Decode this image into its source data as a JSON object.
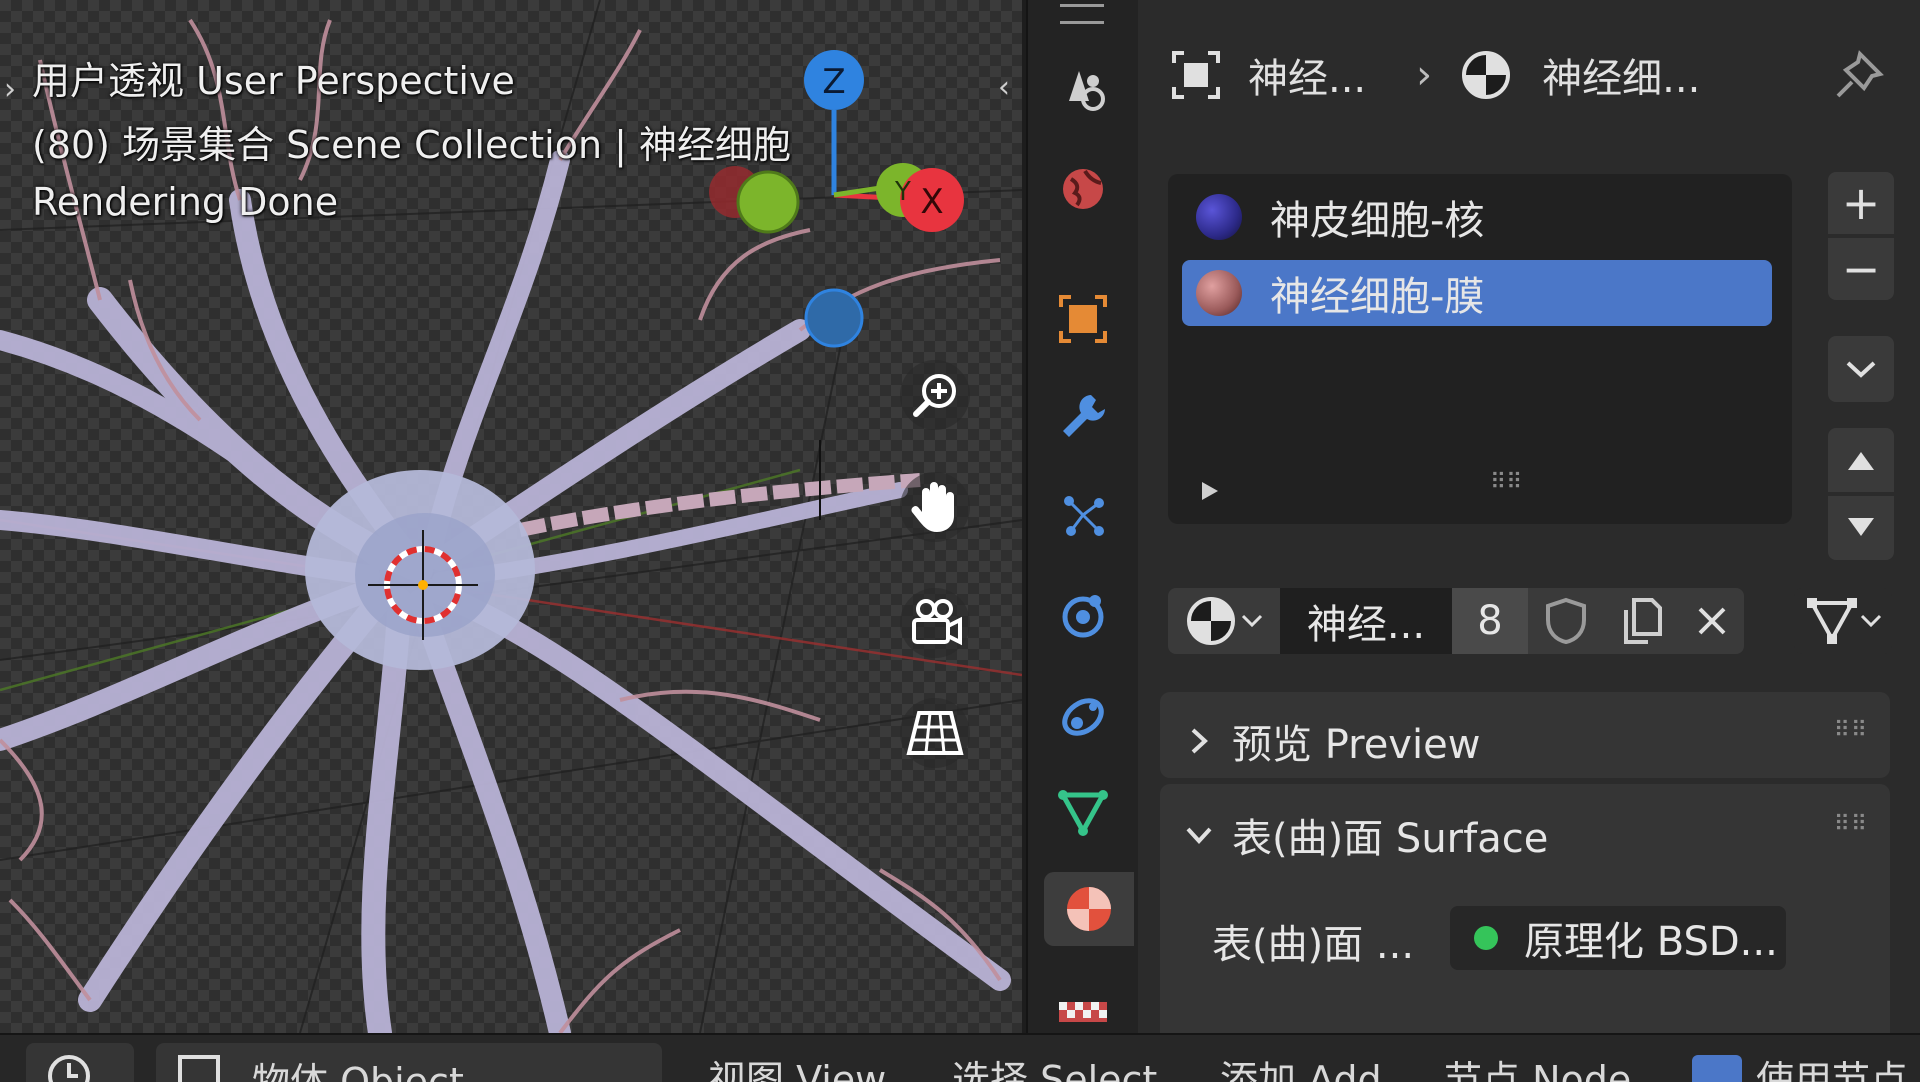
{
  "viewport": {
    "perspective_label": "用户透视 User Perspective",
    "collection_label": "(80) 场景集合 Scene Collection | 神经细胞",
    "status_label": "Rendering Done",
    "gizmo": {
      "z": "Z",
      "x": "X",
      "y": "Y"
    },
    "tools": [
      "zoom-icon",
      "pan-hand-icon",
      "camera-icon",
      "grid-icon"
    ]
  },
  "properties": {
    "breadcrumb": {
      "object": "神经...",
      "material": "神经细..."
    },
    "materials": [
      {
        "name": "神皮细胞-核",
        "color": "#2d2a8a",
        "selected": false
      },
      {
        "name": "神经细胞-膜",
        "color": "#9a5a5a",
        "selected": true
      }
    ],
    "slot": {
      "material_name": "神经...",
      "user_count": "8"
    },
    "panels": {
      "preview": "预览 Preview",
      "surface": "表(曲)面 Surface",
      "surface_field_label": "表(曲)面 ...",
      "surface_shader": "原理化 BSD..."
    }
  },
  "bottom_bar": {
    "object_mode": "物体 Object",
    "view": "视图 View",
    "select": "选择 Select",
    "add": "添加 Add",
    "node": "节点 Node",
    "use_nodes": "使用节点"
  },
  "colors": {
    "accent_blue": "#4b77c8",
    "axis_x": "#e8343f",
    "axis_y": "#7cb52b",
    "axis_z": "#2f83e0",
    "selected_tab": "#e2513d"
  }
}
